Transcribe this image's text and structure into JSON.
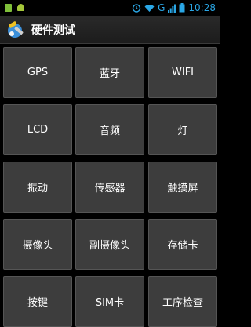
{
  "status_bar": {
    "left_icons": [
      "sd-card-icon",
      "android-debug-icon"
    ],
    "network_label": "G",
    "time": "10:28",
    "accent_color": "#2aa7e6"
  },
  "app": {
    "title": "硬件测试",
    "icon": "tools-app-icon"
  },
  "grid": {
    "items": [
      {
        "label": "GPS"
      },
      {
        "label": "蓝牙"
      },
      {
        "label": "WIFI"
      },
      {
        "label": "LCD"
      },
      {
        "label": "音频"
      },
      {
        "label": "灯"
      },
      {
        "label": "振动"
      },
      {
        "label": "传感器"
      },
      {
        "label": "触摸屏"
      },
      {
        "label": "摄像头"
      },
      {
        "label": "副摄像头"
      },
      {
        "label": "存储卡"
      },
      {
        "label": "按键"
      },
      {
        "label": "SIM卡"
      },
      {
        "label": "工序检查"
      }
    ]
  }
}
